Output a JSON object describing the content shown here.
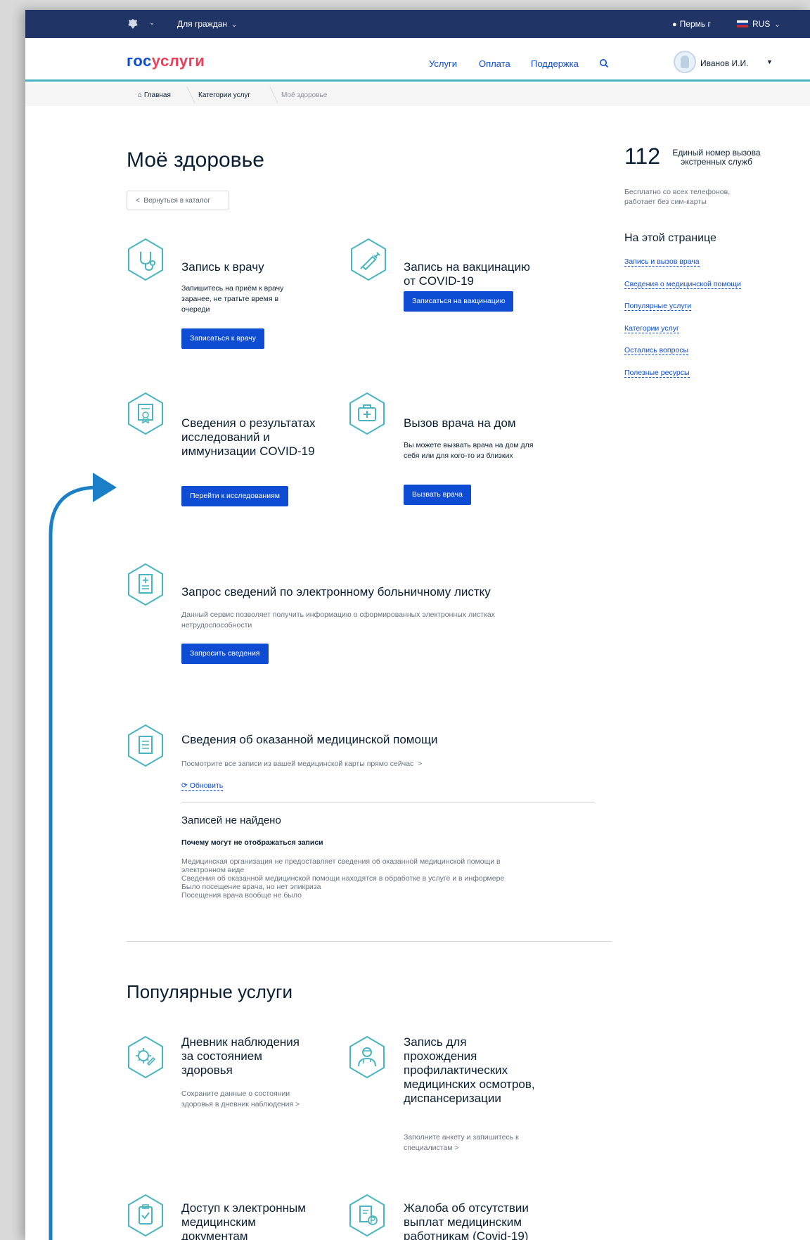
{
  "topbar": {
    "citizens": "Для граждан",
    "city": "Пермь г",
    "lang": "RUS"
  },
  "header": {
    "logo_part1": "гос",
    "logo_part2": "услуги",
    "nav": [
      "Услуги",
      "Оплата",
      "Поддержка"
    ],
    "user": "Иванов И.И."
  },
  "breadcrumb": [
    "Главная",
    "Категории услуг",
    "Моё здоровье"
  ],
  "page_title": "Моё здоровье",
  "back_label": "Вернуться в каталог",
  "services": [
    {
      "title": "Запись к врачу",
      "desc": "Запишитесь на приём к врачу заранее, не тратьте время в очереди",
      "button": "Записаться к врачу",
      "icon": "stethoscope-icon"
    },
    {
      "title": "Запись на вакцинацию от COVID-19",
      "button": "Записаться на вакцинацию",
      "icon": "syringe-icon"
    },
    {
      "title": "Сведения о результатах исследований и иммунизации COVID-19",
      "button": "Перейти к исследованиям",
      "icon": "certificate-icon"
    },
    {
      "title": "Вызов врача на дом",
      "desc": "Вы можете вызвать врача на дом для себя или для кого-то из близких",
      "button": "Вызвать врача",
      "icon": "medkit-icon"
    }
  ],
  "sick_leave": {
    "title": "Запрос сведений по электронному больничному листку",
    "desc": "Данный сервис позволяет получить информацию о сформированных электронных листках нетрудоспособности",
    "button": "Запросить сведения"
  },
  "medical_help": {
    "title": "Сведения об оказанной медицинской помощи",
    "link": "Посмотрите все записи из вашей медицинской карты прямо сейчас",
    "refresh": "Обновить",
    "empty_title": "Записей не найдено",
    "why_title": "Почему могут не отображаться записи",
    "reasons": [
      "Медицинская организация не предоставляет сведения об оказанной медицинской помощи в",
      "электронном виде",
      "Сведения об оказанной медицинской помощи находятся в обработке в услуге и в информере",
      "Было посещение врача, но нет эпикриза",
      "Посещения врача вообще не было"
    ]
  },
  "popular": {
    "title": "Популярные услуги",
    "items": [
      {
        "title": "Дневник наблюдения за состоянием здоровья",
        "desc": "Сохраните данные о состоянии здоровья в дневник наблюдения",
        "icon": "virus-icon"
      },
      {
        "title": "Запись для прохождения профилактических медицинских осмотров, диспансеризации",
        "desc": "Заполните анкету и запишитесь к специалистам",
        "icon": "doctor-icon"
      },
      {
        "title": "Доступ к электронным медицинским документам",
        "icon": "clipboard-icon"
      },
      {
        "title": "Жалоба об отсутствии выплат медицинским работникам (Covid-19)",
        "icon": "document-ruble-icon"
      }
    ]
  },
  "sidebar": {
    "emergency_number": "112",
    "emergency_label": "Единый номер вызова экстренных служб",
    "emergency_desc": "Бесплатно со всех телефонов, работает без сим-карты",
    "toc_title": "На этой странице",
    "toc": [
      "Запись и вызов врача",
      "Сведения о медицинской помощи",
      "Популярные услуги",
      "Категории услуг",
      "Остались вопросы",
      "Полезные ресурсы"
    ]
  },
  "colors": {
    "topbar": "#213466",
    "accent": "#0d4cd3",
    "logo_red": "#ee3f58",
    "icon_teal": "#4ab4c0",
    "annotation_arrow": "#1a7fc7"
  }
}
